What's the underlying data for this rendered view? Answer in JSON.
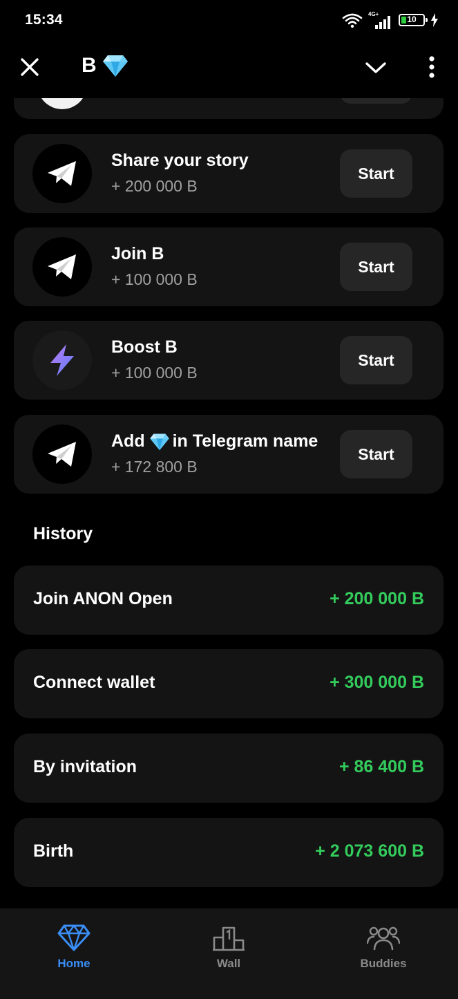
{
  "status_bar": {
    "time": "15:34",
    "network": "4G+",
    "battery": "10"
  },
  "header": {
    "title": "B"
  },
  "tasks": [
    {
      "title": "Share your story",
      "reward": "+ 200 000 B",
      "button": "Start",
      "icon": "telegram-icon"
    },
    {
      "title": "Join B",
      "reward": "+ 100 000 B",
      "button": "Start",
      "icon": "telegram-icon"
    },
    {
      "title": "Boost B",
      "reward": "+ 100 000 B",
      "button": "Start",
      "icon": "lightning-icon"
    },
    {
      "title_prefix": "Add",
      "title_suffix": "in Telegram name",
      "reward": "+ 172 800 B",
      "button": "Start",
      "icon": "telegram-icon"
    }
  ],
  "history": {
    "title": "History",
    "items": [
      {
        "label": "Join ANON Open",
        "amount": "+ 200 000 B"
      },
      {
        "label": "Connect wallet",
        "amount": "+ 300 000 B"
      },
      {
        "label": "By invitation",
        "amount": "+ 86 400 B"
      },
      {
        "label": "Birth",
        "amount": "+ 2 073 600 B"
      }
    ]
  },
  "nav": [
    {
      "label": "Home",
      "icon": "diamond-icon",
      "active": true
    },
    {
      "label": "Wall",
      "icon": "podium-icon"
    },
    {
      "label": "Buddies",
      "icon": "people-icon"
    }
  ],
  "colors": {
    "accent": "#3a8ef6",
    "positive": "#33cc5c",
    "card": "#141414",
    "button": "#262626"
  }
}
